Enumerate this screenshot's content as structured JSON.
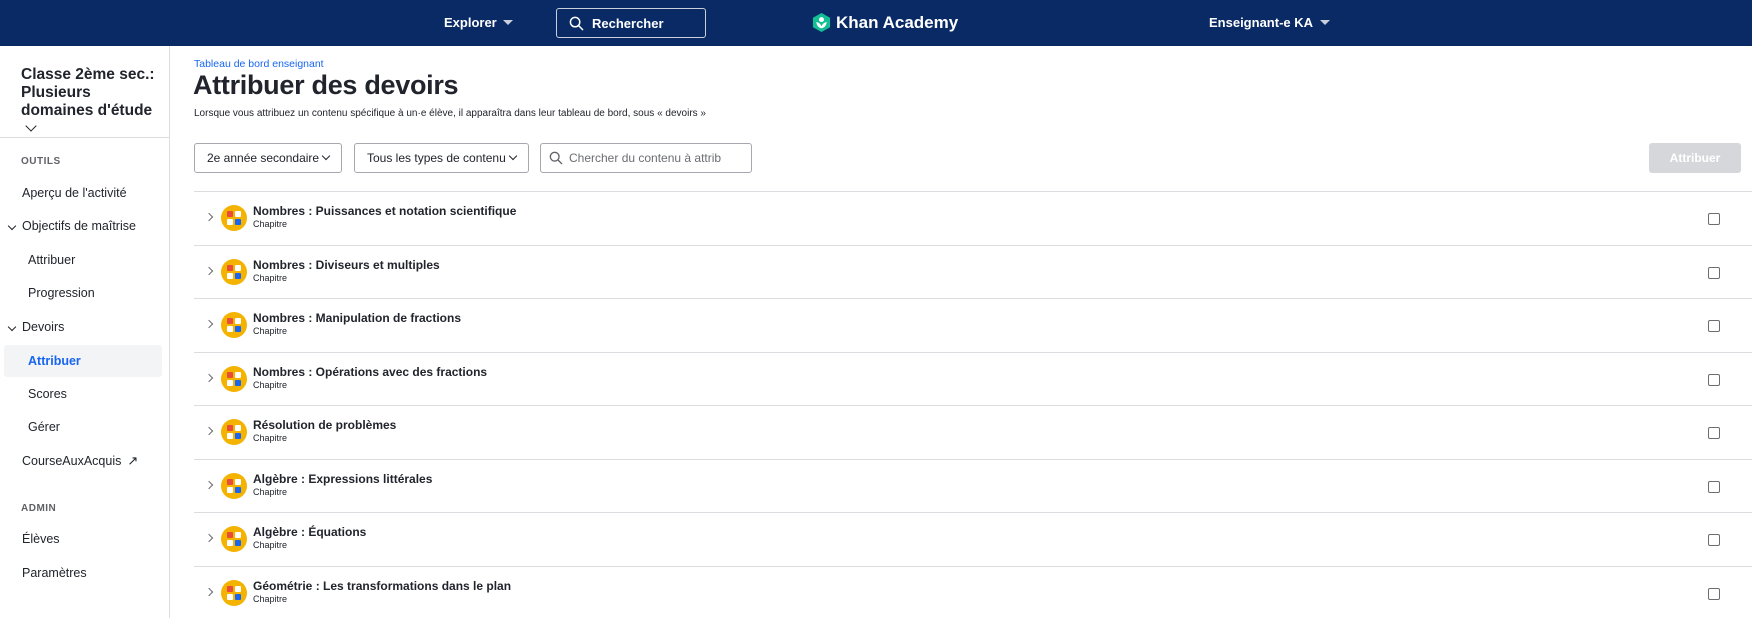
{
  "topbar": {
    "explore_label": "Explorer",
    "search_label": "Rechercher",
    "brand": "Khan Academy",
    "user_label": "Enseignant-e KA"
  },
  "sidebar": {
    "class_name": "Classe 2ème sec.: Plusieurs domaines d'étude",
    "tools_section": "OUTILS",
    "activity_overview": "Aperçu de l'activité",
    "mastery_goals": "Objectifs de maîtrise",
    "mastery_assign": "Attribuer",
    "mastery_progress": "Progression",
    "assignments": "Devoirs",
    "assignments_assign": "Attribuer",
    "assignments_scores": "Scores",
    "assignments_manage": "Gérer",
    "course_challenge": "CourseAuxAcquis",
    "admin_section": "ADMIN",
    "students": "Élèves",
    "settings": "Paramètres"
  },
  "main": {
    "breadcrumb": "Tableau de bord enseignant",
    "title": "Attribuer des devoirs",
    "subtitle": "Lorsque vous attribuez un contenu spécifique à un·e élève, il apparaîtra dans leur tableau de bord, sous « devoirs »",
    "grade_filter": "2e année secondaire",
    "type_filter": "Tous les types de contenu",
    "search_placeholder": "Chercher du contenu à attrib",
    "assign_button": "Attribuer",
    "units": [
      {
        "title": "Nombres : Puissances et notation scientifique",
        "kind": "Chapitre"
      },
      {
        "title": "Nombres : Diviseurs et multiples",
        "kind": "Chapitre"
      },
      {
        "title": "Nombres : Manipulation de fractions",
        "kind": "Chapitre"
      },
      {
        "title": "Nombres : Opérations avec des fractions",
        "kind": "Chapitre"
      },
      {
        "title": "Résolution de problèmes",
        "kind": "Chapitre"
      },
      {
        "title": "Algèbre : Expressions littérales",
        "kind": "Chapitre"
      },
      {
        "title": "Algèbre : Équations",
        "kind": "Chapitre"
      },
      {
        "title": "Géométrie : Les transformations dans le plan",
        "kind": "Chapitre"
      }
    ]
  },
  "colors": {
    "nav_bg": "#0a2a66",
    "accent_blue": "#1865f2",
    "unit_badge": "#f4b300",
    "logo_green": "#14bf96"
  }
}
